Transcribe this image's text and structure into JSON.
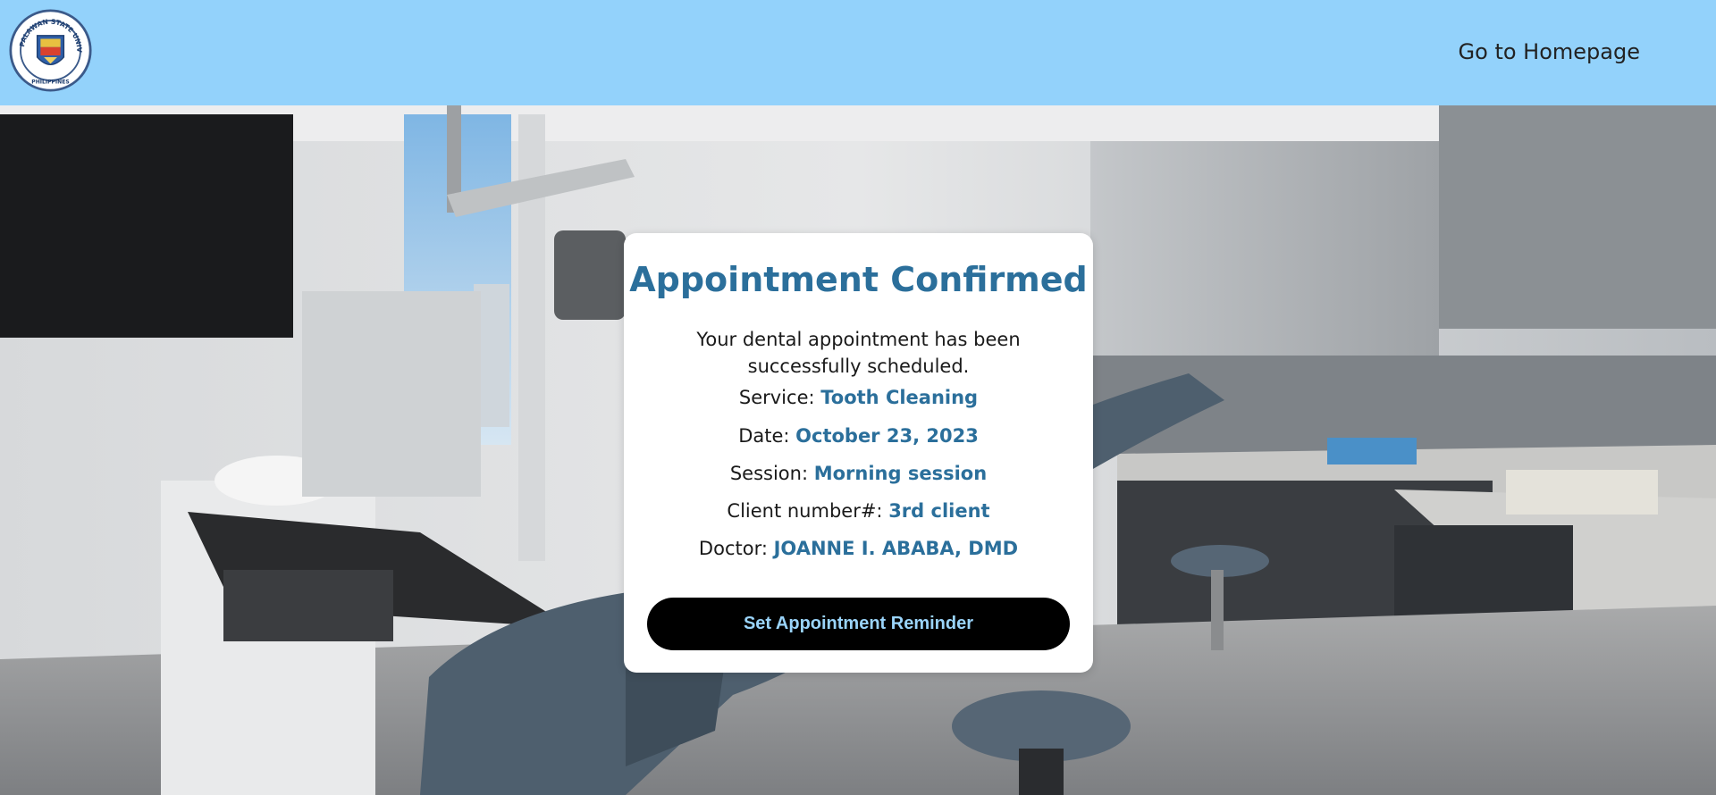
{
  "header": {
    "logo_icon": "palawan-state-university-seal",
    "logo_text": "PALAWAN STATE UNIVERSITY · PHILIPPINES",
    "home_link": "Go to Homepage",
    "background_color": "#93d2fb"
  },
  "hero": {
    "background_scene": "dental-clinic-photo"
  },
  "confirmation": {
    "title": "Appointment Confirmed",
    "message": "Your dental appointment has been successfully scheduled.",
    "details": [
      {
        "label": "Service: ",
        "value": "Tooth Cleaning"
      },
      {
        "label": "Date: ",
        "value": "October 23, 2023"
      },
      {
        "label": "Session: ",
        "value": "Morning session"
      },
      {
        "label": "Client number#: ",
        "value": "3rd client"
      },
      {
        "label": "Doctor: ",
        "value": "JOANNE I. ABABA, DMD"
      }
    ],
    "reminder_button": "Set Appointment Reminder",
    "accent_color": "#2b6f9b"
  }
}
